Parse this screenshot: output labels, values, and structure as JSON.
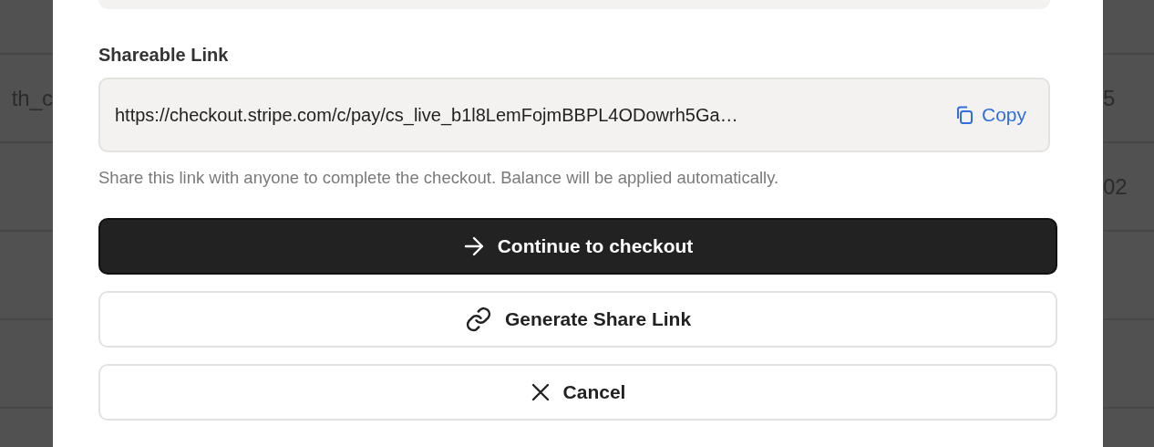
{
  "backdrop": {
    "left_cells": [
      "th_c"
    ],
    "right_cells": [
      "5",
      "02"
    ]
  },
  "share": {
    "label": "Shareable Link",
    "url": "https://checkout.stripe.com/c/pay/cs_live_b1l8LemFojmBBPL4ODowrh5Ga…",
    "copy_button": "Copy",
    "hint": "Share this link with anyone to complete the checkout. Balance will be applied automatically."
  },
  "buttons": [
    {
      "kind": "primary",
      "label": "Continue to checkout"
    },
    {
      "kind": "share",
      "label": "Generate Share Link"
    },
    {
      "kind": "cancel",
      "label": "Cancel"
    }
  ]
}
